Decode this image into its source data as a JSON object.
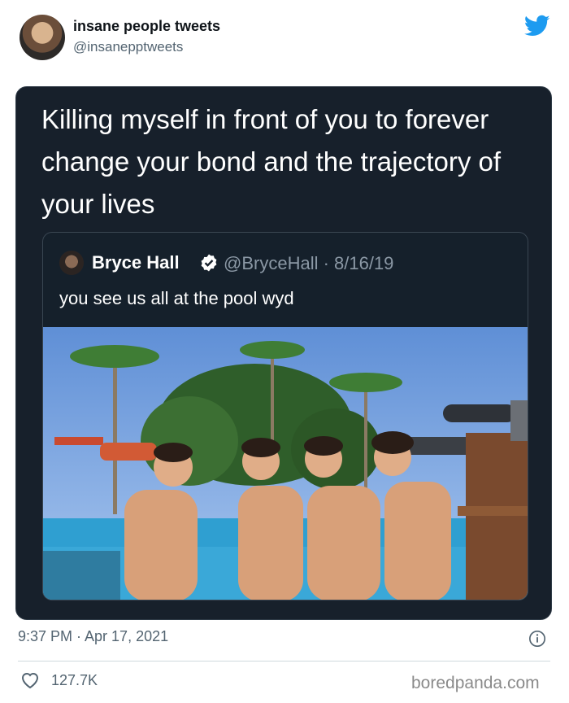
{
  "author": {
    "name": "insane people tweets",
    "handle": "@insanepptweets"
  },
  "tweet": {
    "text": "Killing myself in front of you to forever change your bond and the trajectory of your lives"
  },
  "quoted": {
    "name": "Bryce Hall",
    "handle_date": "@BryceHall · 8/16/19",
    "text": "you see us all at the pool wyd"
  },
  "meta": {
    "timestamp": "9:37 PM · Apr 17, 2021"
  },
  "engagement": {
    "likes": "127.7K"
  },
  "watermark": "boredpanda.com",
  "icons": {
    "brand": "twitter-bird-icon",
    "verified": "verified-badge-icon",
    "info": "info-icon",
    "like": "heart-icon"
  },
  "colors": {
    "twitter_blue": "#1d9bf0",
    "card_bg": "#17202b",
    "secondary_text": "#536471"
  }
}
